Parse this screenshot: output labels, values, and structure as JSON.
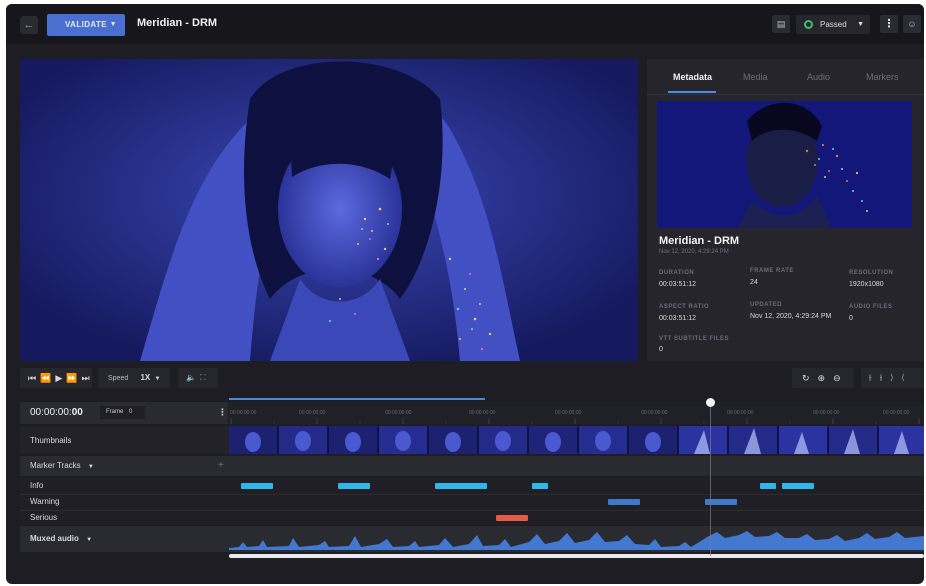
{
  "header": {
    "validate_label": "VALIDATE",
    "title": "Meridian - DRM",
    "status": "Passed"
  },
  "panel": {
    "tabs": [
      "Metadata",
      "Media",
      "Audio",
      "Markers"
    ],
    "active_tab": "Metadata",
    "title": "Meridian - DRM",
    "date": "Nov 12, 2020, 4:29:24 PM",
    "fields": {
      "duration_label": "DURATION",
      "duration": "00:03:51:12",
      "frame_rate_label": "FRAME RATE",
      "frame_rate": "24",
      "resolution_label": "RESOLUTION",
      "resolution": "1920x1080",
      "aspect_ratio_label": "ASPECT RATIO",
      "aspect_ratio": "00:03:51:12",
      "updated_label": "UPDATED",
      "updated": "Nov 12, 2020, 4:29:24 PM",
      "audio_files_label": "AUDIO FILES",
      "audio_files": "0",
      "vtt_label": "VTT SUBTITLE FILES",
      "vtt": "0"
    }
  },
  "controls": {
    "speed_label": "Speed",
    "speed_value": "1X"
  },
  "timeline": {
    "timecode_main": "00:00:00:",
    "timecode_frames": "00",
    "frame_label": "Frame",
    "frame_value": "0",
    "ruler_label": "00:00:00:00",
    "tracks": {
      "thumbnails": "Thumbnails",
      "marker_tracks": "Marker Tracks",
      "info": "Info",
      "warning": "Warning",
      "serious": "Serious",
      "muxed_audio": "Muxed audio"
    }
  },
  "colors": {
    "accent": "#4a6fd0",
    "info": "#2fb6ea",
    "warning": "#3f78c9",
    "serious": "#e35b45",
    "status_ok": "#36c06b"
  }
}
